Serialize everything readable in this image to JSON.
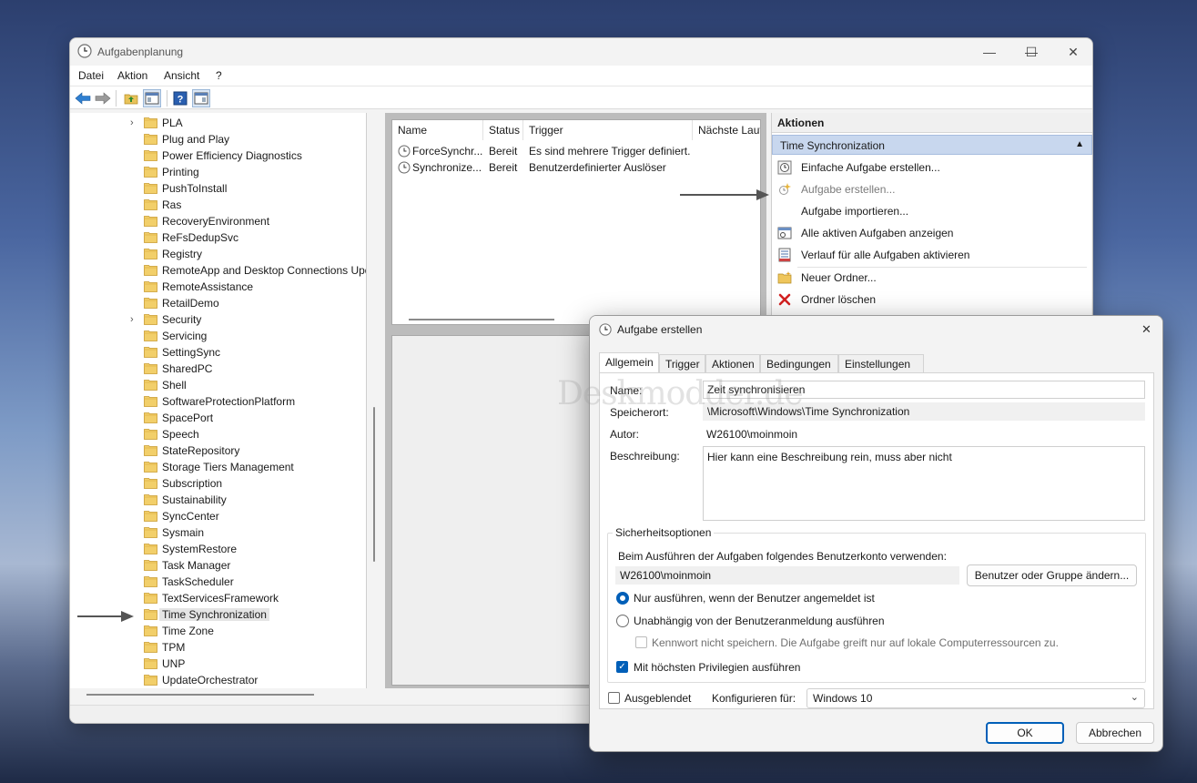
{
  "main_window": {
    "title": "Aufgabenplanung",
    "controls": {
      "minimize": "—",
      "maximize": "☐",
      "close": "✕"
    },
    "menu": [
      "Datei",
      "Aktion",
      "Ansicht",
      "?"
    ]
  },
  "tree": {
    "items": [
      {
        "label": "PLA",
        "expandable": true
      },
      {
        "label": "Plug and Play"
      },
      {
        "label": "Power Efficiency Diagnostics"
      },
      {
        "label": "Printing"
      },
      {
        "label": "PushToInstall"
      },
      {
        "label": "Ras"
      },
      {
        "label": "RecoveryEnvironment"
      },
      {
        "label": "ReFsDedupSvc"
      },
      {
        "label": "Registry"
      },
      {
        "label": "RemoteApp and Desktop Connections Upd"
      },
      {
        "label": "RemoteAssistance"
      },
      {
        "label": "RetailDemo"
      },
      {
        "label": "Security",
        "expandable": true
      },
      {
        "label": "Servicing"
      },
      {
        "label": "SettingSync"
      },
      {
        "label": "SharedPC"
      },
      {
        "label": "Shell"
      },
      {
        "label": "SoftwareProtectionPlatform"
      },
      {
        "label": "SpacePort"
      },
      {
        "label": "Speech"
      },
      {
        "label": "StateRepository"
      },
      {
        "label": "Storage Tiers Management"
      },
      {
        "label": "Subscription"
      },
      {
        "label": "Sustainability"
      },
      {
        "label": "SyncCenter"
      },
      {
        "label": "Sysmain"
      },
      {
        "label": "SystemRestore"
      },
      {
        "label": "Task Manager"
      },
      {
        "label": "TaskScheduler"
      },
      {
        "label": "TextServicesFramework"
      },
      {
        "label": "Time Synchronization",
        "selected": true
      },
      {
        "label": "Time Zone"
      },
      {
        "label": "TPM"
      },
      {
        "label": "UNP"
      },
      {
        "label": "UpdateOrchestrator"
      }
    ]
  },
  "task_list": {
    "columns": [
      "Name",
      "Status",
      "Trigger",
      "Nächste Lauf"
    ],
    "rows": [
      {
        "name": "ForceSynchr...",
        "status": "Bereit",
        "trigger": "Es sind mehrere Trigger definiert."
      },
      {
        "name": "Synchronize...",
        "status": "Bereit",
        "trigger": "Benutzerdefinierter Auslöser"
      }
    ]
  },
  "actions": {
    "header": "Aktionen",
    "group": "Time Synchronization",
    "group_chevron": "▲",
    "items": [
      {
        "label": "Einfache Aufgabe erstellen...",
        "icon": "basic-task-icon"
      },
      {
        "label": "Aufgabe erstellen...",
        "icon": "create-task-icon",
        "disabled": true
      },
      {
        "label": "Aufgabe importieren...",
        "icon": ""
      },
      {
        "label": "Alle aktiven Aufgaben anzeigen",
        "icon": "running-tasks-icon"
      },
      {
        "label": "Verlauf für alle Aufgaben aktivieren",
        "icon": "history-icon"
      },
      {
        "label": "Neuer Ordner...",
        "icon": "new-folder-icon"
      },
      {
        "label": "Ordner löschen",
        "icon": "delete-icon"
      }
    ]
  },
  "dialog": {
    "title": "Aufgabe erstellen",
    "close": "✕",
    "tabs": [
      "Allgemein",
      "Trigger",
      "Aktionen",
      "Bedingungen",
      "Einstellungen"
    ],
    "active_tab": "Allgemein",
    "fields": {
      "name_label": "Name:",
      "name_value": "Zeit synchronisieren",
      "location_label": "Speicherort:",
      "location_value": "\\Microsoft\\Windows\\Time Synchronization",
      "author_label": "Autor:",
      "author_value": "W26100\\moinmoin",
      "description_label": "Beschreibung:",
      "description_value": "Hier kann eine Beschreibung rein, muss aber nicht"
    },
    "security": {
      "title": "Sicherheitsoptionen",
      "account_prompt": "Beim Ausführen der Aufgaben folgendes Benutzerkonto verwenden:",
      "account_value": "W26100\\moinmoin",
      "change_user_button": "Benutzer oder Gruppe ändern...",
      "radio_logged_on": "Nur ausführen, wenn der Benutzer angemeldet ist",
      "radio_independent": "Unabhängig von der Benutzeranmeldung ausführen",
      "no_password": "Kennwort nicht speichern. Die Aufgabe greift nur auf lokale Computerressourcen zu.",
      "highest_privileges": "Mit höchsten Privilegien ausführen",
      "checkmark": "✓"
    },
    "hidden_label": "Ausgeblendet",
    "configure_label": "Konfigurieren für:",
    "configure_value": "Windows 10",
    "ok_button": "OK",
    "cancel_button": "Abbrechen"
  },
  "watermark": "Deskmodder.de",
  "colors": {
    "accent": "#005fb8",
    "action_group_bg": "#c8d7ee"
  }
}
